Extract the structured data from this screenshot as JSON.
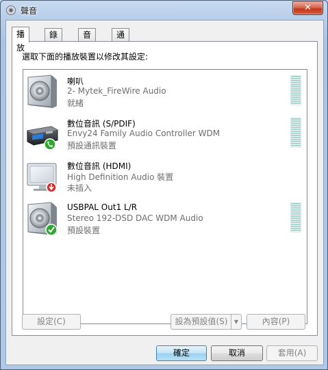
{
  "window": {
    "title": "聲音",
    "close_label": "✕"
  },
  "tabs": [
    {
      "label": "播放"
    },
    {
      "label": "錄製"
    },
    {
      "label": "音效"
    },
    {
      "label": "通訊"
    }
  ],
  "instruction": "選取下面的播放裝置以修改其設定:",
  "devices": [
    {
      "name": "喇叭",
      "description": "2- Mytek_FireWire Audio",
      "status": "就緒",
      "icon": "speaker-icon",
      "badge": null
    },
    {
      "name": "數位音訊 (S/PDIF)",
      "description": "Envy24 Family Audio Controller WDM",
      "status": "預設通訊裝置",
      "icon": "digital-output-device-icon",
      "badge": "phone-badge-icon"
    },
    {
      "name": "數位音訊 (HDMI)",
      "description": "High Definition Audio 裝置",
      "status": "未插入",
      "icon": "monitor-icon",
      "badge": "unplugged-badge-icon"
    },
    {
      "name": "USBPAL Out1 L/R",
      "description": "Stereo 192-DSD DAC WDM Audio",
      "status": "預設裝置",
      "icon": "speaker-icon",
      "badge": "checkmark-badge-icon"
    }
  ],
  "buttons": {
    "configure": "設定(C)",
    "set_default": "設為預設值(S)",
    "properties": "內容(P)",
    "ok": "確定",
    "cancel": "取消",
    "apply": "套用(A)"
  },
  "colors": {
    "title_bar": "#b9d1ea",
    "close_button": "#c74a2f",
    "level_meter": "#a8d4cf",
    "default_badge": "#2fa82f",
    "unplugged_badge": "#d82b2b"
  }
}
